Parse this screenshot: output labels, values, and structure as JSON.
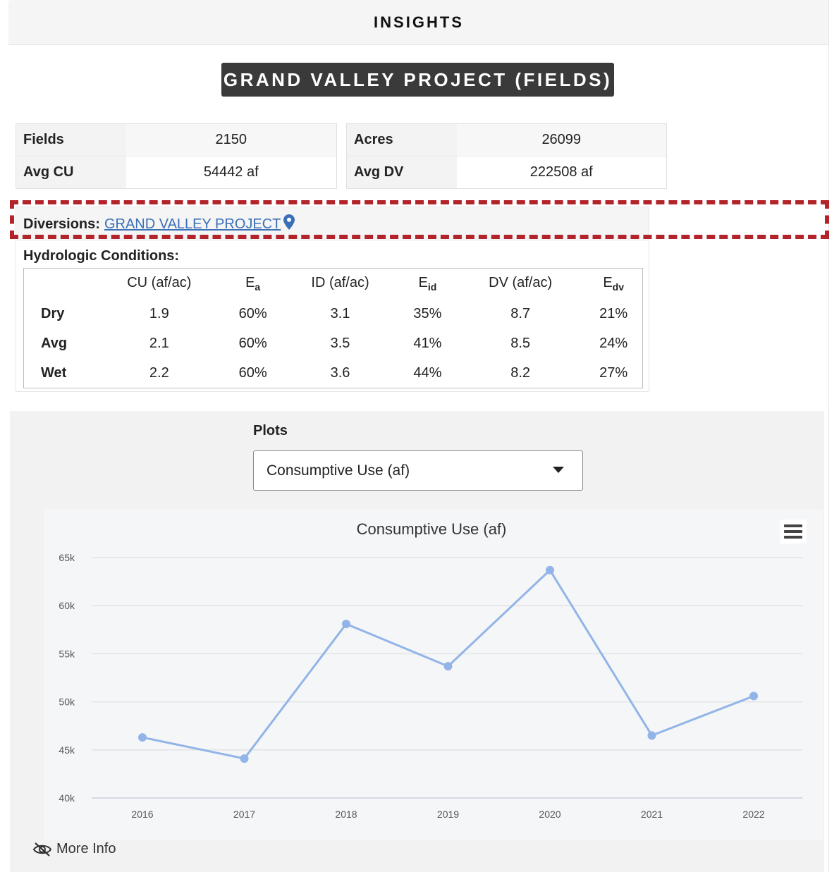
{
  "header": {
    "title": "INSIGHTS"
  },
  "project": {
    "title": "GRAND VALLEY PROJECT (FIELDS)"
  },
  "stats_left": [
    {
      "label": "Fields",
      "value": "2150"
    },
    {
      "label": "Avg CU",
      "value": "54442 af"
    }
  ],
  "stats_right": [
    {
      "label": "Acres",
      "value": "26099"
    },
    {
      "label": "Avg DV",
      "value": "222508 af"
    }
  ],
  "diversions": {
    "label": "Diversions:",
    "link_text": "GRAND VALLEY PROJECT",
    "icon": "map-pin-icon"
  },
  "hydrologic": {
    "label": "Hydrologic Conditions:",
    "columns": [
      {
        "text": "CU (af/ac)",
        "sub": ""
      },
      {
        "text": "E",
        "sub": "a"
      },
      {
        "text": "ID (af/ac)",
        "sub": ""
      },
      {
        "text": "E",
        "sub": "id"
      },
      {
        "text": "DV (af/ac)",
        "sub": ""
      },
      {
        "text": "E",
        "sub": "dv"
      }
    ],
    "rows": [
      {
        "name": "Dry",
        "values": [
          "1.9",
          "60%",
          "3.1",
          "35%",
          "8.7",
          "21%"
        ]
      },
      {
        "name": "Avg",
        "values": [
          "2.1",
          "60%",
          "3.5",
          "41%",
          "8.5",
          "24%"
        ]
      },
      {
        "name": "Wet",
        "values": [
          "2.2",
          "60%",
          "3.6",
          "44%",
          "8.2",
          "27%"
        ]
      }
    ]
  },
  "plots": {
    "label": "Plots",
    "selected": "Consumptive Use (af)"
  },
  "more_info": {
    "label": "More Info",
    "icon": "eye-slash-icon"
  },
  "colors": {
    "series": "#92b4e8",
    "highlight": "#b3232a",
    "title_bg": "#3a3a3a"
  },
  "chart_data": {
    "type": "line",
    "title": "Consumptive Use (af)",
    "xlabel": "",
    "ylabel": "",
    "x": [
      "2016",
      "2017",
      "2018",
      "2019",
      "2020",
      "2021",
      "2022"
    ],
    "series": [
      {
        "values": [
          46300,
          44100,
          58100,
          53700,
          63700,
          46500,
          50600
        ]
      }
    ],
    "ylim": [
      40000,
      65000
    ],
    "yticks": [
      "40k",
      "45k",
      "50k",
      "55k",
      "60k",
      "65k"
    ],
    "grid": true,
    "legend": "none"
  }
}
